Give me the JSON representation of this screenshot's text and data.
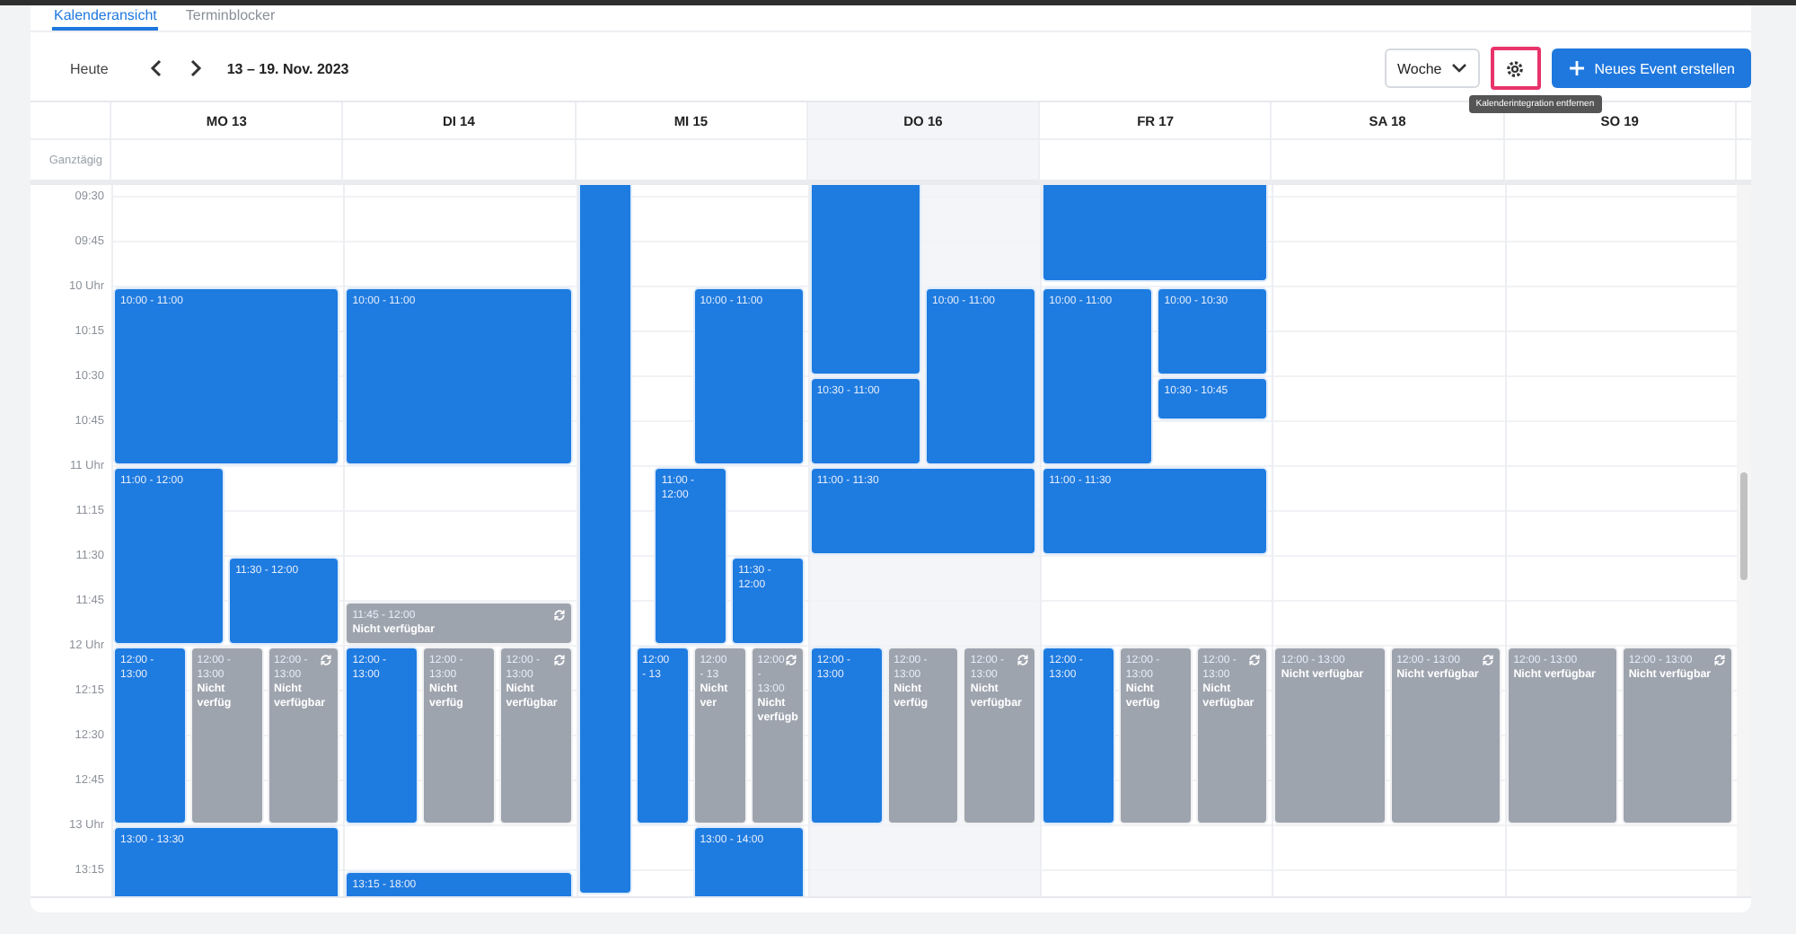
{
  "tabs": [
    {
      "label": "Kalenderansicht",
      "selected": true
    },
    {
      "label": "Terminblocker",
      "selected": false
    }
  ],
  "toolbar": {
    "today": "Heute",
    "range": "13 – 19. Nov. 2023",
    "view": "Woche",
    "new_event": "Neues Event erstellen",
    "tooltip": "Kalenderintegration entfernen"
  },
  "allday_label": "Ganztägig",
  "time_labels": [
    "09:30",
    "09:45",
    "10 Uhr",
    "10:15",
    "10:30",
    "10:45",
    "11 Uhr",
    "11:15",
    "11:30",
    "11:45",
    "12 Uhr",
    "12:15",
    "12:30",
    "12:45",
    "13 Uhr",
    "13:15"
  ],
  "days": [
    {
      "label": "MO 13",
      "today": false,
      "events": [
        {
          "kind": "event",
          "time": "10:00 - 11:00"
        },
        {
          "kind": "event",
          "time": "11:00 - 12:00"
        },
        {
          "kind": "event",
          "time": "11:30 - 12:00"
        },
        {
          "kind": "event",
          "time": "12:00 - 13:00"
        },
        {
          "kind": "blocked",
          "time": "12:00 - 13:00",
          "title": "Nicht verfüg",
          "recurring": false
        },
        {
          "kind": "blocked",
          "time": "12:00 - 13:00",
          "title": "Nicht verfügbar",
          "recurring": true
        },
        {
          "kind": "event",
          "time": "13:00 - 13:30"
        }
      ]
    },
    {
      "label": "DI 14",
      "today": false,
      "events": [
        {
          "kind": "event",
          "time": "10:00 - 11:00"
        },
        {
          "kind": "blocked",
          "time": "11:45 - 12:00",
          "title": "Nicht verfügbar",
          "recurring": true
        },
        {
          "kind": "event",
          "time": "12:00 - 13:00"
        },
        {
          "kind": "blocked",
          "time": "12:00 - 13:00",
          "title": "Nicht verfüg",
          "recurring": false
        },
        {
          "kind": "blocked",
          "time": "12:00 - 13:00",
          "title": "Nicht verfügbar",
          "recurring": true
        },
        {
          "kind": "event",
          "time": "13:15 - 18:00"
        }
      ]
    },
    {
      "label": "MI 15",
      "today": false,
      "events": [
        {
          "kind": "continuing",
          "level": 1
        },
        {
          "kind": "event",
          "time": "10:00 - 11:00"
        },
        {
          "kind": "event",
          "time": "11:00 - 12:00"
        },
        {
          "kind": "event",
          "time": "11:30 - 12:00"
        },
        {
          "kind": "event",
          "time": "12:00 - 13"
        },
        {
          "kind": "blocked",
          "time": "12:00 - 13",
          "title": "Nicht ver",
          "recurring": false
        },
        {
          "kind": "blocked",
          "time": "12:00 - 13:00",
          "title": "Nicht verfügb",
          "recurring": true
        },
        {
          "kind": "event",
          "time": "13:00 - 14:00"
        }
      ]
    },
    {
      "label": "DO 16",
      "today": true,
      "events": [
        {
          "kind": "continuing",
          "level": 0.27
        },
        {
          "kind": "event",
          "time": "10:00 - 11:00"
        },
        {
          "kind": "event",
          "time": "10:30 - 11:00"
        },
        {
          "kind": "event",
          "time": "11:00 - 11:30"
        },
        {
          "kind": "event",
          "time": "12:00 - 13:00"
        },
        {
          "kind": "blocked",
          "time": "12:00 - 13:00",
          "title": "Nicht verfüg",
          "recurring": false
        },
        {
          "kind": "blocked",
          "time": "12:00 - 13:00",
          "title": "Nicht verfügbar",
          "recurring": true
        }
      ]
    },
    {
      "label": "FR 17",
      "today": false,
      "events": [
        {
          "kind": "continuing",
          "level": 0.14
        },
        {
          "kind": "event",
          "time": "10:00 - 11:00"
        },
        {
          "kind": "event",
          "time": "10:00 - 10:30"
        },
        {
          "kind": "event",
          "time": "10:30 - 10:45"
        },
        {
          "kind": "event",
          "time": "11:00 - 11:30"
        },
        {
          "kind": "event",
          "time": "12:00 - 13:00"
        },
        {
          "kind": "blocked",
          "time": "12:00 - 13:00",
          "title": "Nicht verfüg",
          "recurring": false
        },
        {
          "kind": "blocked",
          "time": "12:00 - 13:00",
          "title": "Nicht verfügbar",
          "recurring": true
        }
      ]
    },
    {
      "label": "SA 18",
      "today": false,
      "events": [
        {
          "kind": "blocked",
          "time": "12:00 - 13:00",
          "title": "Nicht verfügbar",
          "recurring": false
        },
        {
          "kind": "blocked",
          "time": "12:00 - 13:00",
          "title": "Nicht verfügbar",
          "recurring": true
        }
      ]
    },
    {
      "label": "SO 19",
      "today": false,
      "events": [
        {
          "kind": "blocked",
          "time": "12:00 - 13:00",
          "title": "Nicht verfügbar",
          "recurring": false
        },
        {
          "kind": "blocked",
          "time": "12:00 - 13:00",
          "title": "Nicht verfügbar",
          "recurring": true
        }
      ]
    }
  ]
}
